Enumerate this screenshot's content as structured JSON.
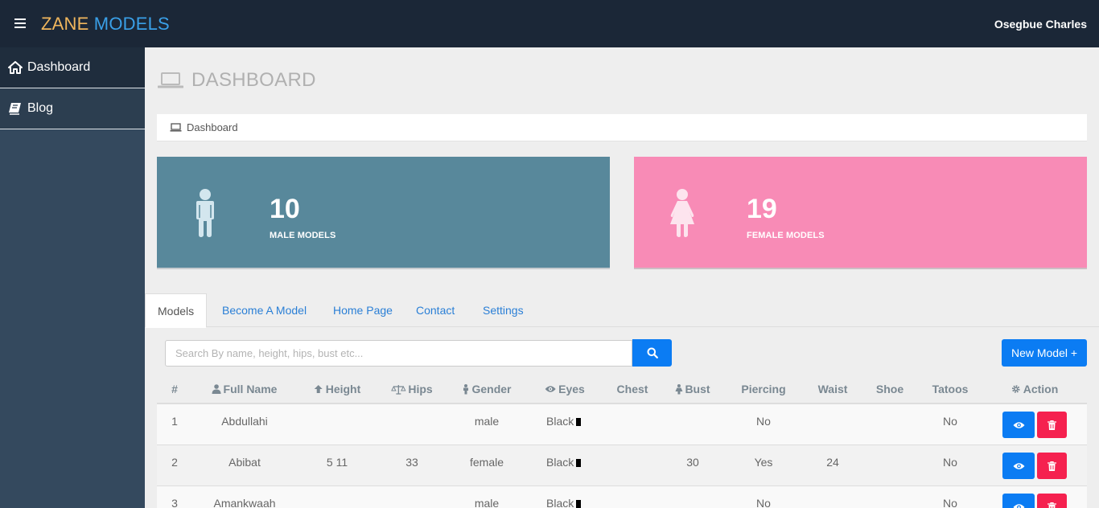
{
  "brand": {
    "part1": "ZANE",
    "part2": "MODELS"
  },
  "user": {
    "name": "Osegbue Charles"
  },
  "sidebar": {
    "items": [
      {
        "label": "Dashboard",
        "icon": "home-icon"
      },
      {
        "label": "Blog",
        "icon": "book-icon"
      }
    ]
  },
  "page": {
    "title": "DASHBOARD",
    "breadcrumb": "Dashboard"
  },
  "stats": {
    "male": {
      "count": "10",
      "label": "MALE MODELS",
      "color": "#58889b"
    },
    "female": {
      "count": "19",
      "label": "FEMALE MODELS",
      "color": "#f88bb6"
    }
  },
  "tabs": [
    "Models",
    "Become A Model",
    "Home Page",
    "Contact",
    "Settings"
  ],
  "search": {
    "placeholder": "Search By name, height, hips, bust etc..."
  },
  "new_model_label": "New Model +",
  "table": {
    "headers": [
      "#",
      "Full Name",
      "Height",
      "Hips",
      "Gender",
      "Eyes",
      "Chest",
      "Bust",
      "Piercing",
      "Waist",
      "Shoe",
      "Tatoos",
      "Action"
    ],
    "rows": [
      [
        "1",
        "Abdullahi",
        "",
        "",
        "male",
        "Black",
        "",
        "",
        "No",
        "",
        "",
        "No"
      ],
      [
        "2",
        "Abibat",
        "5 11",
        "33",
        "female",
        "Black",
        "",
        "30",
        "Yes",
        "24",
        "",
        "No"
      ],
      [
        "3",
        "Amankwaah",
        "",
        "",
        "male",
        "Black",
        "",
        "",
        "No",
        "",
        "",
        "No"
      ]
    ]
  },
  "colors": {
    "topbar": "#1b2737",
    "sidebar": "#34495e",
    "primary": "#0b7cf3",
    "danger": "#f5214f"
  }
}
